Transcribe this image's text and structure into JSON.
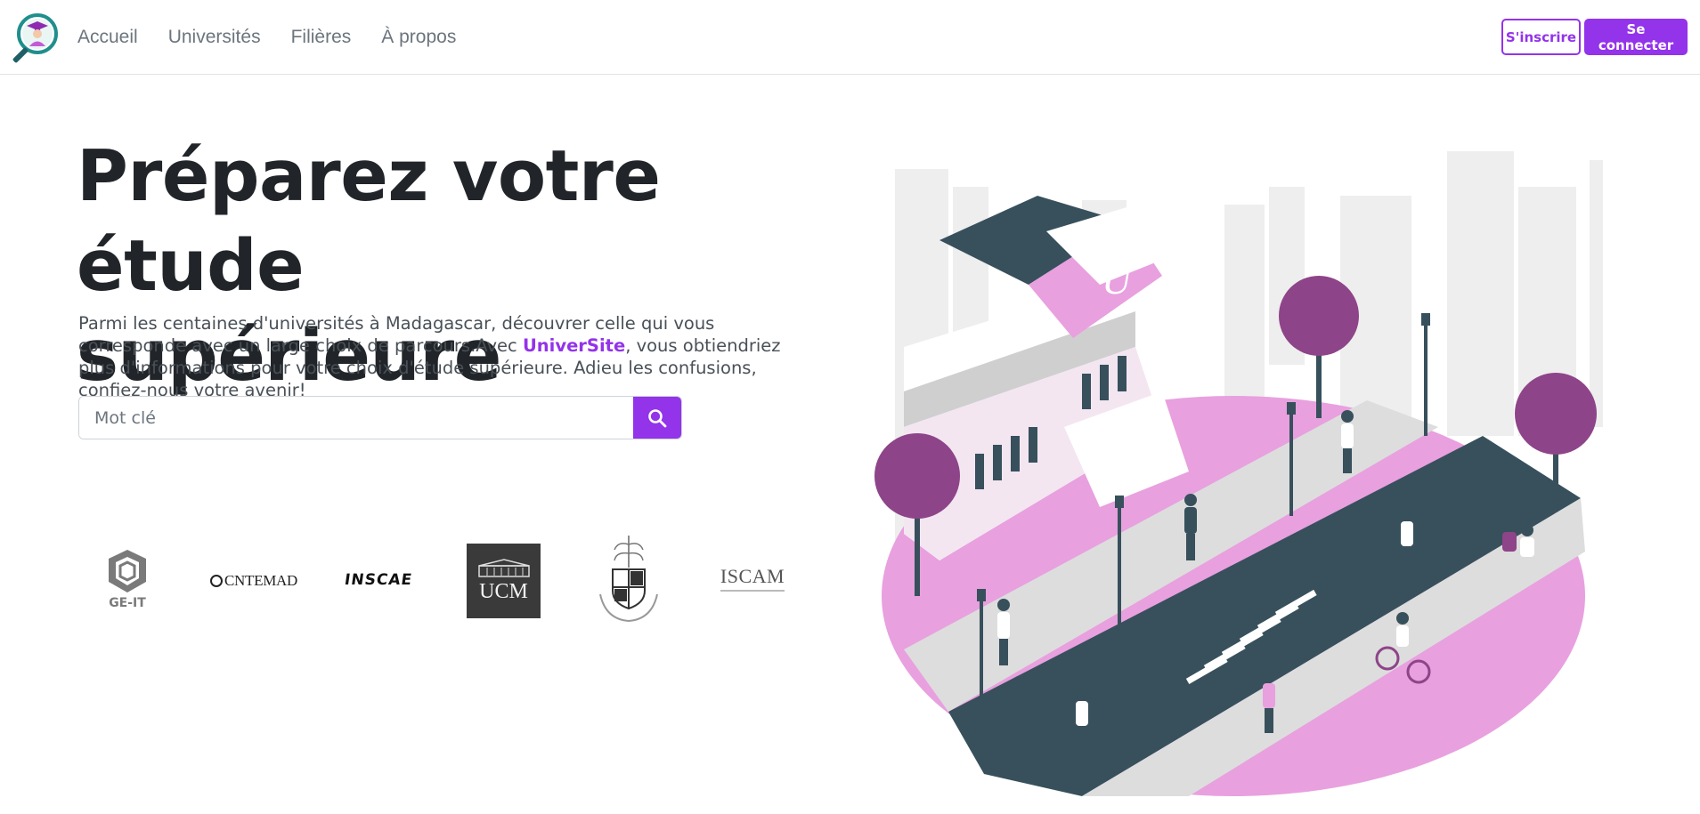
{
  "nav": {
    "links": [
      "Accueil",
      "Universités",
      "Filières",
      "À propos"
    ],
    "signup_label": "S'inscrire",
    "login_label": "Se connecter"
  },
  "hero": {
    "title_line1": "Préparez votre étude",
    "title_line2": "supérieure",
    "desc_before": "Parmi les centaines d'universités à Madagascar, découvrer celle qui vous corresponde avec un large choix de parcours.Avec ",
    "desc_brand": "UniverSite",
    "desc_after": ", vous obtiendriez plus d'informations pour votre choix d'étude supérieure. Adieu les confusions, confiez-nous votre avenir!"
  },
  "search": {
    "placeholder": "Mot clé",
    "value": ""
  },
  "universities": [
    {
      "name": "GE-IT",
      "label": "GE-IT"
    },
    {
      "name": "CNTEMAD",
      "label": "CNTEMAD"
    },
    {
      "name": "INSCAE",
      "label": "INSCAE"
    },
    {
      "name": "UCM",
      "label": "UCM"
    },
    {
      "name": "University crest",
      "label": ""
    },
    {
      "name": "ISCAM",
      "label": "ISCAM"
    }
  ],
  "icons": {
    "logo": "magnifier-graduate-logo",
    "search": "search-icon"
  },
  "colors": {
    "accent": "#9333ea",
    "nav_text": "#6c757d",
    "heading": "#212529",
    "illustration_pink": "#e8a0df",
    "illustration_purple": "#8e4488",
    "illustration_slate": "#37505c"
  }
}
